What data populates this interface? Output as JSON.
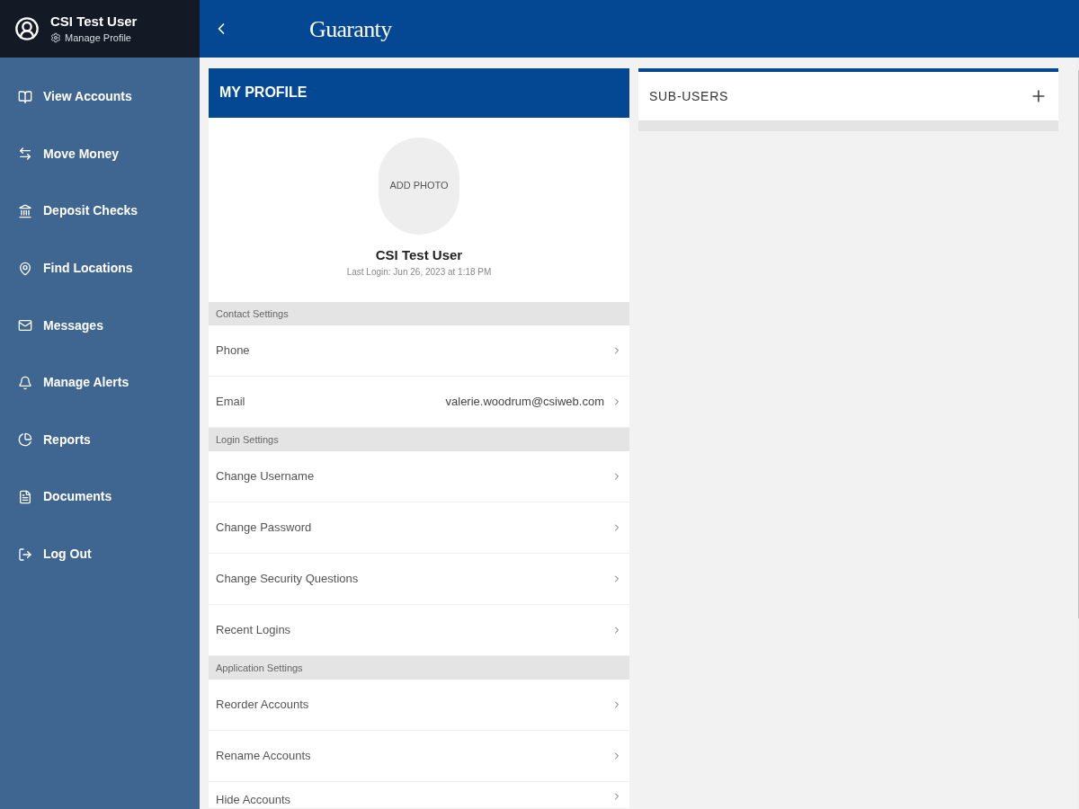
{
  "user": {
    "name": "CSI Test User",
    "manage_link": "Manage Profile"
  },
  "sidebar": {
    "items": [
      {
        "label": "View Accounts"
      },
      {
        "label": "Move Money"
      },
      {
        "label": "Deposit Checks"
      },
      {
        "label": "Find Locations"
      },
      {
        "label": "Messages"
      },
      {
        "label": "Manage Alerts"
      },
      {
        "label": "Reports"
      },
      {
        "label": "Documents"
      },
      {
        "label": "Log Out"
      }
    ]
  },
  "header": {
    "logo": "Guaranty"
  },
  "profile": {
    "title": "MY PROFILE",
    "photo_label": "ADD PHOTO",
    "name": "CSI Test User",
    "last_login": "Last Login: Jun 26, 2023 at 1:18 PM",
    "sections": [
      {
        "title": "Contact Settings",
        "rows": [
          {
            "label": "Phone"
          },
          {
            "label": "Email",
            "value": "valerie.woodrum@csiweb.com"
          }
        ]
      },
      {
        "title": "Login Settings",
        "rows": [
          {
            "label": "Change Username"
          },
          {
            "label": "Change Password"
          },
          {
            "label": "Change Security Questions"
          },
          {
            "label": "Recent Logins"
          }
        ]
      },
      {
        "title": "Application Settings",
        "rows": [
          {
            "label": "Reorder Accounts"
          },
          {
            "label": "Rename Accounts"
          },
          {
            "label": "Hide Accounts"
          }
        ]
      }
    ]
  },
  "sub_users": {
    "title": "SUB-USERS"
  }
}
